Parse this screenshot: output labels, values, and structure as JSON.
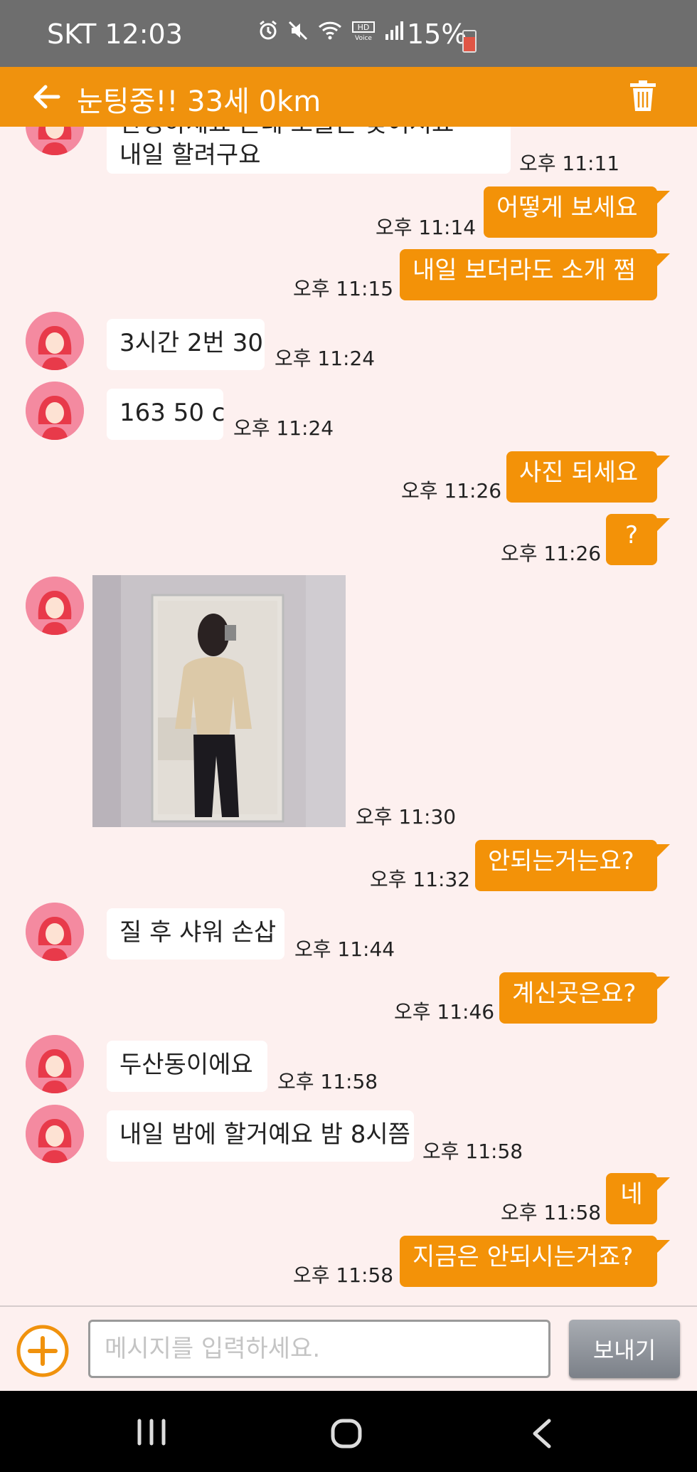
{
  "status_bar": {
    "carrier_time": "SKT 12:03",
    "battery": "15%",
    "icons": [
      "alarm-icon",
      "mute-icon",
      "wifi-icon",
      "hd-voice-icon",
      "signal-icon",
      "battery-icon"
    ]
  },
  "header": {
    "title": "눈팅중!! 33세 0km",
    "back_icon": "back-arrow-icon",
    "delete_icon": "trash-icon",
    "color": "#f0920d"
  },
  "messages": [
    {
      "from": "them",
      "lines": [
        "안녕하세요 근데 오늘은 늦어서요",
        "내일 할려구요"
      ],
      "time": "오후 11:11"
    },
    {
      "from": "me",
      "text": "어떻게 보세요",
      "time": "오후 11:14"
    },
    {
      "from": "me",
      "text": "내일  보더라도 소개 쩜",
      "time": "오후 11:15"
    },
    {
      "from": "them",
      "text": "3시간 2번 30",
      "time": "오후 11:24"
    },
    {
      "from": "them",
      "text": "163 50 c",
      "time": "오후 11:24"
    },
    {
      "from": "me",
      "text": "사진 되세요",
      "time": "오후 11:26"
    },
    {
      "from": "me",
      "text": "?",
      "time": "오후 11:26"
    },
    {
      "from": "them",
      "type": "photo",
      "time": "오후 11:30"
    },
    {
      "from": "me",
      "text": "안되는거는요?",
      "time": "오후 11:32"
    },
    {
      "from": "them",
      "text": "질 후 샤워 손삽",
      "time": "오후 11:44"
    },
    {
      "from": "me",
      "text": "계신곳은요?",
      "time": "오후 11:46"
    },
    {
      "from": "them",
      "text": "두산동이에요",
      "time": "오후 11:58"
    },
    {
      "from": "them",
      "text": "내일 밤에 할거예요 밤 8시쯤",
      "time": "오후 11:58"
    },
    {
      "from": "me",
      "text": "네",
      "time": "오후 11:58"
    },
    {
      "from": "me",
      "text": "지금은 안되시는거죠?",
      "time": "오후 11:58"
    }
  ],
  "input": {
    "placeholder": "메시지를 입력하세요.",
    "value": "",
    "send_label": "보내기",
    "plus_icon": "plus-circle-icon"
  },
  "nav_bar": {
    "icons": [
      "recent-apps-icon",
      "home-icon",
      "back-icon"
    ]
  },
  "colors": {
    "accent": "#f39208",
    "chat_background": "#fdf0ef",
    "incoming_bubble": "#ffffff",
    "status_bar": "#6e6e6e"
  }
}
